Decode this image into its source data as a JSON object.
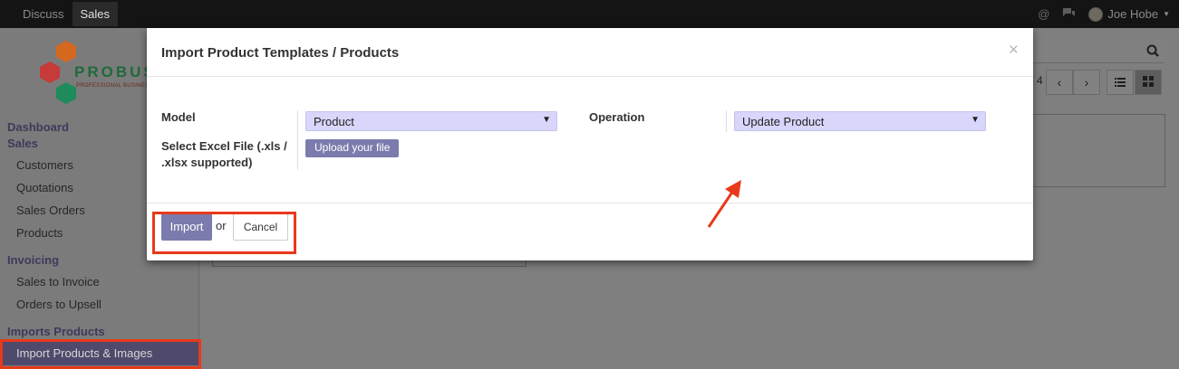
{
  "topbar": {
    "menu": [
      "Discuss",
      "Sales"
    ],
    "active_menu": "Sales",
    "user_name": "Joe Hobe",
    "icons": [
      "at-icon",
      "chat-icon",
      "avatar",
      "caret-down-icon"
    ]
  },
  "logo": {
    "word": "PROBUS",
    "tagline": "PROFESSIONAL BUSINES"
  },
  "sidebar": {
    "sections": [
      {
        "title": "Dashboard"
      },
      {
        "title": "Sales",
        "items": [
          "Customers",
          "Quotations",
          "Sales Orders",
          "Products"
        ]
      },
      {
        "title": "Invoicing",
        "items": [
          "Sales to Invoice",
          "Orders to Upsell"
        ]
      },
      {
        "title": "Imports Products",
        "items": [
          "Import Products & Images"
        ]
      }
    ],
    "selected_item": "Import Products & Images"
  },
  "background": {
    "pager_text": "4",
    "icons": [
      "search-icon",
      "chevron-left-icon",
      "chevron-right-icon",
      "list-view-icon",
      "kanban-view-icon"
    ]
  },
  "modal": {
    "title": "Import Product Templates / Products",
    "close": "×",
    "model_label": "Model",
    "model_value": "Product",
    "file_label": "Select Excel File (.xls / .xlsx supported)",
    "upload_label": "Upload your file",
    "operation_label": "Operation",
    "operation_value": "Update Product",
    "import_label": "Import",
    "or_text": "or",
    "cancel_label": "Cancel"
  },
  "colors": {
    "accent": "#7c7bad",
    "select_bg": "#d8d6fb",
    "highlight": "#e8391a"
  }
}
